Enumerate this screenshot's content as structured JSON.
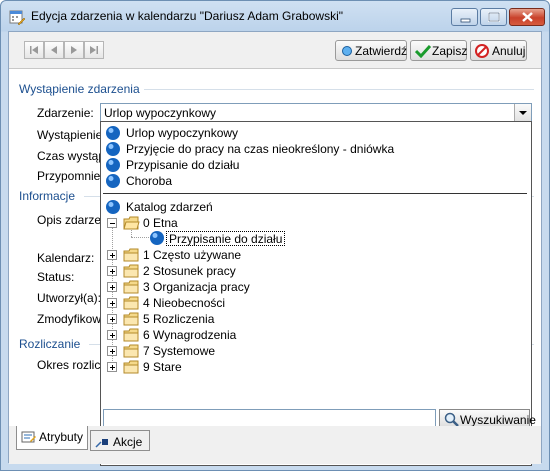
{
  "window": {
    "title": "Edycja zdarzenia w kalendarzu \"Dariusz Adam Grabowski\""
  },
  "toolbar": {
    "confirm_label": "Zatwierdź",
    "save_label": "Zapisz",
    "cancel_label": "Anuluj"
  },
  "sections": {
    "occurrence": "Wystąpienie zdarzenia",
    "information": "Informacje",
    "settlement": "Rozliczanie"
  },
  "fields": {
    "event_label": "Zdarzenie:",
    "occurrence_label": "Wystąpienie",
    "time_label": "Czas wystąp",
    "reminder_label": "Przypomnien",
    "description_label": "Opis zdarzen",
    "calendar_label": "Kalendarz:",
    "status_label": "Status:",
    "created_label": "Utworzył(a):",
    "modified_label": "Zmodyfikowa",
    "period_label": "Okres rozlicz"
  },
  "combo": {
    "value": "Urlop wypoczynkowy"
  },
  "dropdown": {
    "recent_items": [
      "Urlop wypoczynkowy",
      "Przyjęcie do pracy na czas nieokreślony - dniówka",
      "Przypisanie do działu",
      "Choroba"
    ],
    "catalog_label": "Katalog zdarzeń",
    "tree": {
      "expanded_folder": "0 Etna",
      "selected_child": "Przypisanie do działu",
      "folders": [
        "1 Często używane",
        "2 Stosunek pracy",
        "3 Organizacja pracy",
        "4 Nieobecności",
        "5 Rozliczenia",
        "6 Wynagrodzenia",
        "7 Systemowe",
        "9 Stare"
      ]
    },
    "search_placeholder": "",
    "search_button": "Wyszukiwanie"
  },
  "tabs": {
    "attributes": "Atrybuty",
    "actions": "Akcje"
  },
  "colors": {
    "accent": "#1c4f8f",
    "info_blue": "#1565c0",
    "folder": "#e9c46a"
  }
}
